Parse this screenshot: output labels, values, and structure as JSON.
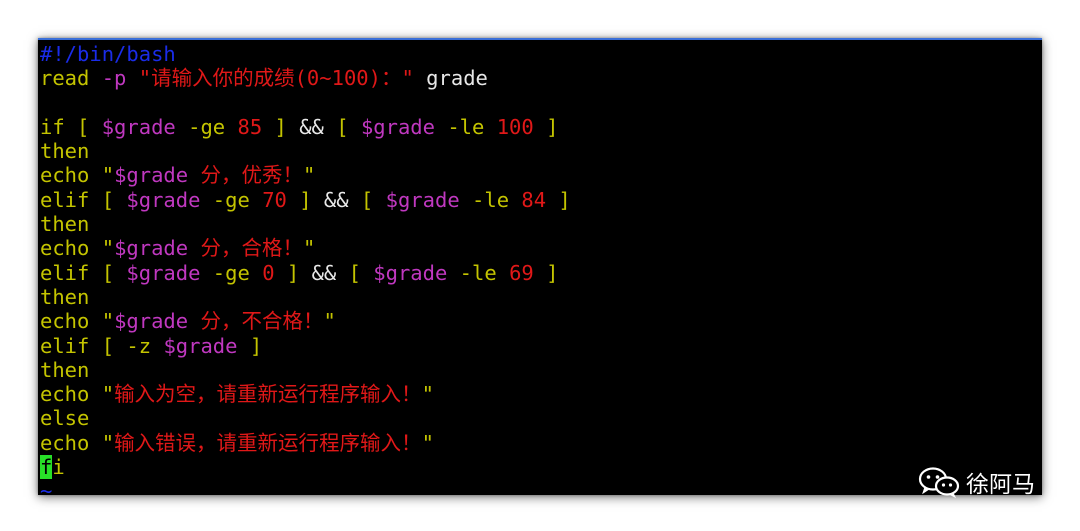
{
  "terminal": {
    "lines": [
      {
        "parts": [
          {
            "t": "#!/bin/bash",
            "k": "shebang"
          }
        ]
      },
      {
        "parts": [
          {
            "t": "read",
            "k": "kw"
          },
          {
            "t": " ",
            "k": "op"
          },
          {
            "t": "-p",
            "k": "flag"
          },
          {
            "t": " ",
            "k": "op"
          },
          {
            "t": "\"请输入你的成绩(0~100)：\"",
            "k": "str"
          },
          {
            "t": " grade",
            "k": "op"
          }
        ]
      },
      {
        "parts": []
      },
      {
        "parts": [
          {
            "t": "if",
            "k": "kw"
          },
          {
            "t": " [ ",
            "k": "kw"
          },
          {
            "t": "$grade",
            "k": "var"
          },
          {
            "t": " -ge ",
            "k": "kw"
          },
          {
            "t": "85",
            "k": "num"
          },
          {
            "t": " ] ",
            "k": "kw"
          },
          {
            "t": "&&",
            "k": "op"
          },
          {
            "t": " [ ",
            "k": "kw"
          },
          {
            "t": "$grade",
            "k": "var"
          },
          {
            "t": " -le ",
            "k": "kw"
          },
          {
            "t": "100",
            "k": "num"
          },
          {
            "t": " ]",
            "k": "kw"
          }
        ]
      },
      {
        "parts": [
          {
            "t": "then",
            "k": "kw"
          }
        ]
      },
      {
        "parts": [
          {
            "t": "echo",
            "k": "kw"
          },
          {
            "t": " \"",
            "k": "kw"
          },
          {
            "t": "$grade",
            "k": "var"
          },
          {
            "t": " 分，优秀！",
            "k": "str"
          },
          {
            "t": "\"",
            "k": "kw"
          }
        ]
      },
      {
        "parts": [
          {
            "t": "elif",
            "k": "kw"
          },
          {
            "t": " [ ",
            "k": "kw"
          },
          {
            "t": "$grade",
            "k": "var"
          },
          {
            "t": " -ge ",
            "k": "kw"
          },
          {
            "t": "70",
            "k": "num"
          },
          {
            "t": " ] ",
            "k": "kw"
          },
          {
            "t": "&&",
            "k": "op"
          },
          {
            "t": " [ ",
            "k": "kw"
          },
          {
            "t": "$grade",
            "k": "var"
          },
          {
            "t": " -le ",
            "k": "kw"
          },
          {
            "t": "84",
            "k": "num"
          },
          {
            "t": " ]",
            "k": "kw"
          }
        ]
      },
      {
        "parts": [
          {
            "t": "then",
            "k": "kw"
          }
        ]
      },
      {
        "parts": [
          {
            "t": "echo",
            "k": "kw"
          },
          {
            "t": " \"",
            "k": "kw"
          },
          {
            "t": "$grade",
            "k": "var"
          },
          {
            "t": " 分，合格！",
            "k": "str"
          },
          {
            "t": "\"",
            "k": "kw"
          }
        ]
      },
      {
        "parts": [
          {
            "t": "elif",
            "k": "kw"
          },
          {
            "t": " [ ",
            "k": "kw"
          },
          {
            "t": "$grade",
            "k": "var"
          },
          {
            "t": " -ge ",
            "k": "kw"
          },
          {
            "t": "0",
            "k": "num"
          },
          {
            "t": " ] ",
            "k": "kw"
          },
          {
            "t": "&&",
            "k": "op"
          },
          {
            "t": " [ ",
            "k": "kw"
          },
          {
            "t": "$grade",
            "k": "var"
          },
          {
            "t": " -le ",
            "k": "kw"
          },
          {
            "t": "69",
            "k": "num"
          },
          {
            "t": " ]",
            "k": "kw"
          }
        ]
      },
      {
        "parts": [
          {
            "t": "then",
            "k": "kw"
          }
        ]
      },
      {
        "parts": [
          {
            "t": "echo",
            "k": "kw"
          },
          {
            "t": " \"",
            "k": "kw"
          },
          {
            "t": "$grade",
            "k": "var"
          },
          {
            "t": " 分，不合格！",
            "k": "str"
          },
          {
            "t": "\"",
            "k": "kw"
          }
        ]
      },
      {
        "parts": [
          {
            "t": "elif",
            "k": "kw"
          },
          {
            "t": " [ ",
            "k": "kw"
          },
          {
            "t": "-z",
            "k": "kw"
          },
          {
            "t": " ",
            "k": "kw"
          },
          {
            "t": "$grade",
            "k": "var"
          },
          {
            "t": " ]",
            "k": "kw"
          }
        ]
      },
      {
        "parts": [
          {
            "t": "then",
            "k": "kw"
          }
        ]
      },
      {
        "parts": [
          {
            "t": "echo",
            "k": "kw"
          },
          {
            "t": " \"",
            "k": "kw"
          },
          {
            "t": "输入为空，请重新运行程序输入！",
            "k": "str"
          },
          {
            "t": "\"",
            "k": "kw"
          }
        ]
      },
      {
        "parts": [
          {
            "t": "else",
            "k": "kw"
          }
        ]
      },
      {
        "parts": [
          {
            "t": "echo",
            "k": "kw"
          },
          {
            "t": " \"",
            "k": "kw"
          },
          {
            "t": "输入错误，请重新运行程序输入！",
            "k": "str"
          },
          {
            "t": "\"",
            "k": "kw"
          }
        ]
      },
      {
        "parts": [
          {
            "t": "f",
            "k": "cursor"
          },
          {
            "t": "i",
            "k": "kw"
          }
        ]
      },
      {
        "parts": [
          {
            "t": "~",
            "k": "tilde"
          }
        ]
      }
    ]
  },
  "watermark": {
    "text": "徐阿马",
    "icon": "wechat-icon"
  },
  "colors": {
    "background": "#000000",
    "keyword": "#c4c400",
    "string": "#e01818",
    "variable": "#c038c0",
    "shebang": "#1a2ce8",
    "cursor": "#28e028"
  }
}
